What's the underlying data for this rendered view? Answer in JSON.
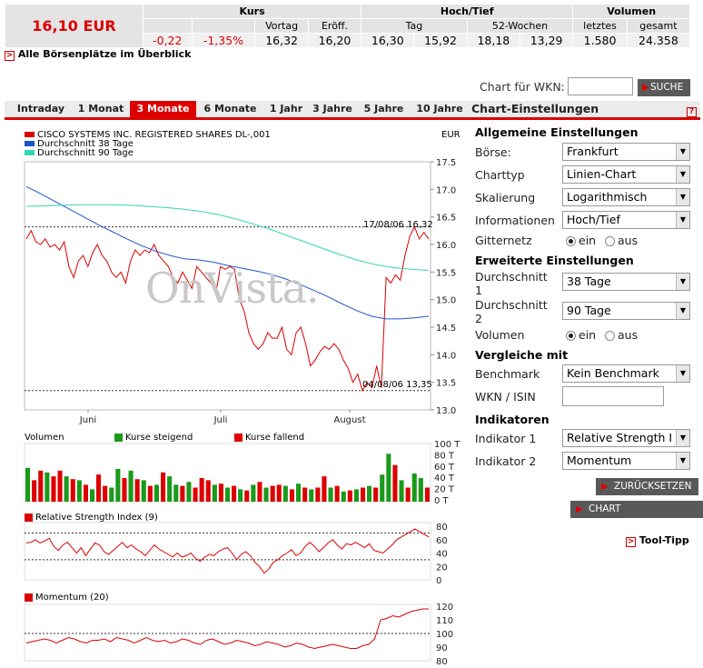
{
  "quote": {
    "price": "16,10 EUR",
    "header": {
      "kurs": "Kurs",
      "hochtief": "Hoch/Tief",
      "volumen": "Volumen"
    },
    "subheader": {
      "vortag": "Vortag",
      "eroeff": "Eröff.",
      "tag": "Tag",
      "wochen": "52-Wochen",
      "letztes": "letztes",
      "gesamt": "gesamt"
    },
    "values": {
      "change": "-0,22",
      "change_pct": "-1,35%",
      "vortag": "16,32",
      "eroeff": "16,20",
      "tag_hoch": "16,30",
      "tag_tief": "15,92",
      "w52_hoch": "18,18",
      "w52_tief": "13,29",
      "letztes": "1.580",
      "gesamt": "24.358"
    },
    "link": "Alle Börsenplätze im Überblick"
  },
  "search": {
    "label": "Chart für WKN:",
    "value": "",
    "button": "SUCHE"
  },
  "tabs": [
    "Intraday",
    "1 Monat",
    "3 Monate",
    "6 Monate",
    "1 Jahr",
    "3 Jahre",
    "5 Jahre",
    "10 Jahre"
  ],
  "active_tab": "3 Monate",
  "settings": {
    "title": "Chart-Einstellungen",
    "help": "?",
    "general_title": "Allgemeine Einstellungen",
    "boerse_label": "Börse:",
    "boerse_value": "Frankfurt",
    "charttyp_label": "Charttyp",
    "charttyp_value": "Linien-Chart",
    "skalierung_label": "Skalierung",
    "skalierung_value": "Logarithmisch",
    "info_label": "Informationen",
    "info_value": "Hoch/Tief",
    "gitter_label": "Gitternetz",
    "on_label": "ein",
    "off_label": "aus",
    "extended_title": "Erweiterte Einstellungen",
    "ds1_label": "Durchschnitt 1",
    "ds1_value": "38 Tage",
    "ds2_label": "Durchschnitt 2",
    "ds2_value": "90 Tage",
    "volumen_label": "Volumen",
    "compare_title": "Vergleiche mit",
    "benchmark_label": "Benchmark",
    "benchmark_value": "Kein Benchmark",
    "wkn_label": "WKN / ISIN",
    "wkn_value": "",
    "indicators_title": "Indikatoren",
    "ind1_label": "Indikator 1",
    "ind1_value": "Relative Strength I",
    "ind2_label": "Indikator 2",
    "ind2_value": "Momentum",
    "reset_button": "ZURÜCKSETZEN",
    "update_button": "CHART AKTUALISIEREN",
    "tooltip_link": "Tool-Tipp"
  },
  "colors": {
    "red": "#dd0000",
    "blue": "#1c55cc",
    "cyan": "#33d6b4",
    "green": "#1a9a1a",
    "accent": "#dd0000"
  },
  "watermark": "OnVista.",
  "chart_data": [
    {
      "type": "line",
      "title": "",
      "unit": "EUR",
      "legend": [
        "CISCO SYSTEMS INC. REGISTERED SHARES DL-,001",
        "Durchschnitt 38 Tage",
        "Durchschnitt 90 Tage"
      ],
      "x_tick_labels": [
        "Juni",
        "Juli",
        "August"
      ],
      "y_ticks": [
        13.0,
        13.5,
        14.0,
        14.5,
        15.0,
        15.5,
        16.0,
        16.5,
        17.0,
        17.5
      ],
      "ylim": [
        13.0,
        17.5
      ],
      "annotations": {
        "high": "17/08/06 16,32",
        "low": "04/08/06 13,35",
        "high_value": 16.32,
        "low_value": 13.35
      },
      "series": [
        {
          "name": "CISCO SYSTEMS INC. REGISTERED SHARES DL-,001",
          "values": [
            16.1,
            16.25,
            16.05,
            16.0,
            16.1,
            15.95,
            16.0,
            15.9,
            16.05,
            15.6,
            15.4,
            15.7,
            15.8,
            15.6,
            15.85,
            16.0,
            15.8,
            15.7,
            15.5,
            15.4,
            15.5,
            15.3,
            15.7,
            15.9,
            15.8,
            15.9,
            15.85,
            16.0,
            15.8,
            15.7,
            15.6,
            15.4,
            15.3,
            15.5,
            15.35,
            15.2,
            15.6,
            15.5,
            15.4,
            15.3,
            15.1,
            15.6,
            15.55,
            15.6,
            15.55,
            15.0,
            14.8,
            14.4,
            14.2,
            14.1,
            14.2,
            14.4,
            14.3,
            14.3,
            14.5,
            14.1,
            14.0,
            14.4,
            14.5,
            14.2,
            13.8,
            13.9,
            14.05,
            14.15,
            14.1,
            14.2,
            14.1,
            13.9,
            13.75,
            13.5,
            13.65,
            13.35,
            13.5,
            13.4,
            13.8,
            13.4,
            15.4,
            15.3,
            15.45,
            15.35,
            15.8,
            16.15,
            16.32,
            16.1,
            16.22,
            16.1
          ]
        },
        {
          "name": "Durchschnitt 38 Tage",
          "values": [
            17.05,
            16.92,
            16.78,
            16.64,
            16.5,
            16.36,
            16.23,
            16.1,
            15.98,
            15.88,
            15.8,
            15.74,
            15.72,
            15.68,
            15.62,
            15.57,
            15.52,
            15.46,
            15.38,
            15.28,
            15.17,
            15.05,
            14.92,
            14.8,
            14.7,
            14.65,
            14.65,
            14.67,
            14.7
          ]
        },
        {
          "name": "Durchschnitt 90 Tage",
          "values": [
            16.69,
            16.7,
            16.71,
            16.72,
            16.72,
            16.72,
            16.71,
            16.69,
            16.67,
            16.64,
            16.6,
            16.54,
            16.46,
            16.37,
            16.27,
            16.15,
            16.04,
            15.92,
            15.81,
            15.71,
            15.63,
            15.58,
            15.55,
            15.53
          ]
        }
      ]
    },
    {
      "type": "bar",
      "title": "Volumen",
      "legend": [
        "Kurse steigend",
        "Kurse fallend"
      ],
      "y_tick_labels": [
        "100 T",
        "80 T",
        "60 T",
        "40 T",
        "20 T",
        "0 T"
      ],
      "ylim": [
        0,
        100
      ],
      "values": [
        60,
        38,
        55,
        52,
        45,
        55,
        45,
        40,
        38,
        30,
        22,
        48,
        28,
        25,
        58,
        42,
        55,
        40,
        38,
        28,
        30,
        52,
        45,
        30,
        28,
        35,
        25,
        42,
        38,
        30,
        32,
        25,
        28,
        22,
        20,
        30,
        35,
        25,
        28,
        30,
        28,
        22,
        32,
        25,
        22,
        25,
        45,
        25,
        28,
        18,
        20,
        22,
        25,
        28,
        25,
        48,
        85,
        65,
        38,
        25,
        50,
        42,
        25
      ],
      "rising": [
        1,
        0,
        0,
        1,
        0,
        0,
        1,
        0,
        1,
        0,
        1,
        0,
        0,
        1,
        1,
        0,
        1,
        0,
        1,
        0,
        1,
        0,
        1,
        1,
        0,
        1,
        0,
        0,
        0,
        1,
        0,
        1,
        0,
        1,
        0,
        1,
        0,
        1,
        0,
        0,
        1,
        0,
        1,
        0,
        1,
        0,
        0,
        1,
        0,
        1,
        0,
        1,
        0,
        1,
        0,
        1,
        1,
        0,
        1,
        0,
        1,
        1,
        0
      ]
    },
    {
      "type": "line",
      "title": "Relative Strength Index (9)",
      "y_ticks": [
        0,
        20,
        40,
        60,
        80
      ],
      "ylim": [
        0,
        80
      ],
      "reference_lines": [
        30,
        70
      ],
      "values": [
        55,
        56,
        60,
        55,
        58,
        62,
        50,
        44,
        52,
        56,
        48,
        40,
        48,
        36,
        46,
        55,
        52,
        42,
        38,
        44,
        50,
        56,
        48,
        52,
        46,
        42,
        36,
        44,
        52,
        46,
        42,
        38,
        34,
        40,
        34,
        36,
        40,
        32,
        28,
        34,
        38,
        36,
        42,
        46,
        48,
        40,
        30,
        38,
        42,
        36,
        26,
        20,
        10,
        16,
        26,
        30,
        36,
        40,
        45,
        36,
        40,
        50,
        56,
        50,
        42,
        48,
        55,
        60,
        52,
        46,
        54,
        52,
        56,
        52,
        48,
        54,
        44,
        42,
        40,
        46,
        52,
        60,
        64,
        68,
        72,
        76,
        72,
        68,
        64
      ]
    },
    {
      "type": "line",
      "title": "Momentum (20)",
      "y_ticks": [
        80,
        90,
        100,
        110,
        120
      ],
      "ylim": [
        80,
        120
      ],
      "reference_lines": [
        100
      ],
      "values": [
        93,
        94,
        95,
        96,
        95,
        93,
        95,
        97,
        96,
        94,
        93,
        95,
        95,
        96,
        94,
        97,
        96,
        95,
        93,
        95,
        97,
        95,
        94,
        95,
        93,
        94,
        96,
        95,
        93,
        92,
        95,
        96,
        94,
        92,
        93,
        95,
        94,
        93,
        91,
        92,
        94,
        93,
        92,
        90,
        91,
        93,
        92,
        90,
        89,
        90,
        91,
        92,
        91,
        90,
        89,
        89,
        91,
        92,
        96,
        110,
        111,
        113,
        112,
        114,
        116,
        117,
        118,
        118
      ]
    }
  ]
}
